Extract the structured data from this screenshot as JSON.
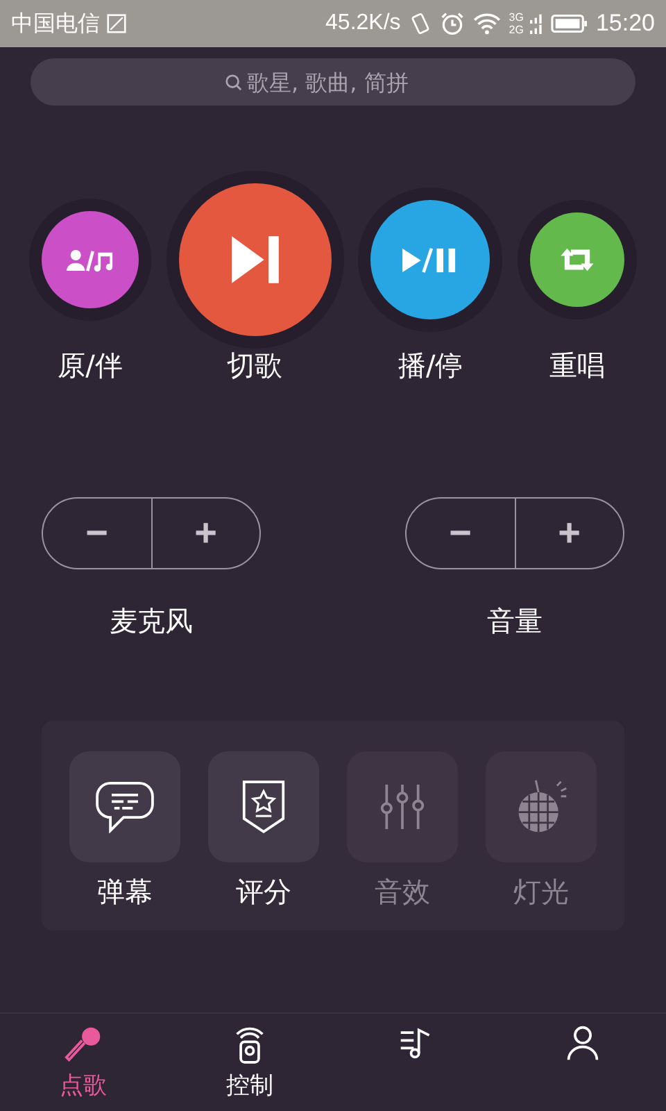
{
  "status_bar": {
    "carrier": "中国电信",
    "speed": "45.2K/s",
    "network": "3G",
    "network2": "2G",
    "time": "15:20"
  },
  "search": {
    "placeholder": "歌星, 歌曲, 简拼"
  },
  "controls": [
    {
      "kind": "vocal",
      "label": "原/伴",
      "color": "#cb4fc6"
    },
    {
      "kind": "next",
      "label": "切歌",
      "color": "#e4583f"
    },
    {
      "kind": "playpause",
      "label": "播/停",
      "color": "#27a6e3"
    },
    {
      "kind": "repeat",
      "label": "重唱",
      "color": "#64b94c"
    }
  ],
  "adjusters": [
    {
      "label": "麦克风",
      "minus": "−",
      "plus": "+"
    },
    {
      "label": "音量",
      "minus": "−",
      "plus": "+"
    }
  ],
  "features": [
    {
      "kind": "comment",
      "label": "弹幕",
      "disabled": false
    },
    {
      "kind": "score",
      "label": "评分",
      "disabled": false
    },
    {
      "kind": "equalizer",
      "label": "音效",
      "disabled": true
    },
    {
      "kind": "disco",
      "label": "灯光",
      "disabled": true
    }
  ],
  "tabs": [
    {
      "kind": "mic",
      "label": "点歌",
      "selected": true
    },
    {
      "kind": "remote",
      "label": "控制",
      "selected": false
    },
    {
      "kind": "list",
      "selected": false
    },
    {
      "kind": "user",
      "selected": false
    }
  ]
}
